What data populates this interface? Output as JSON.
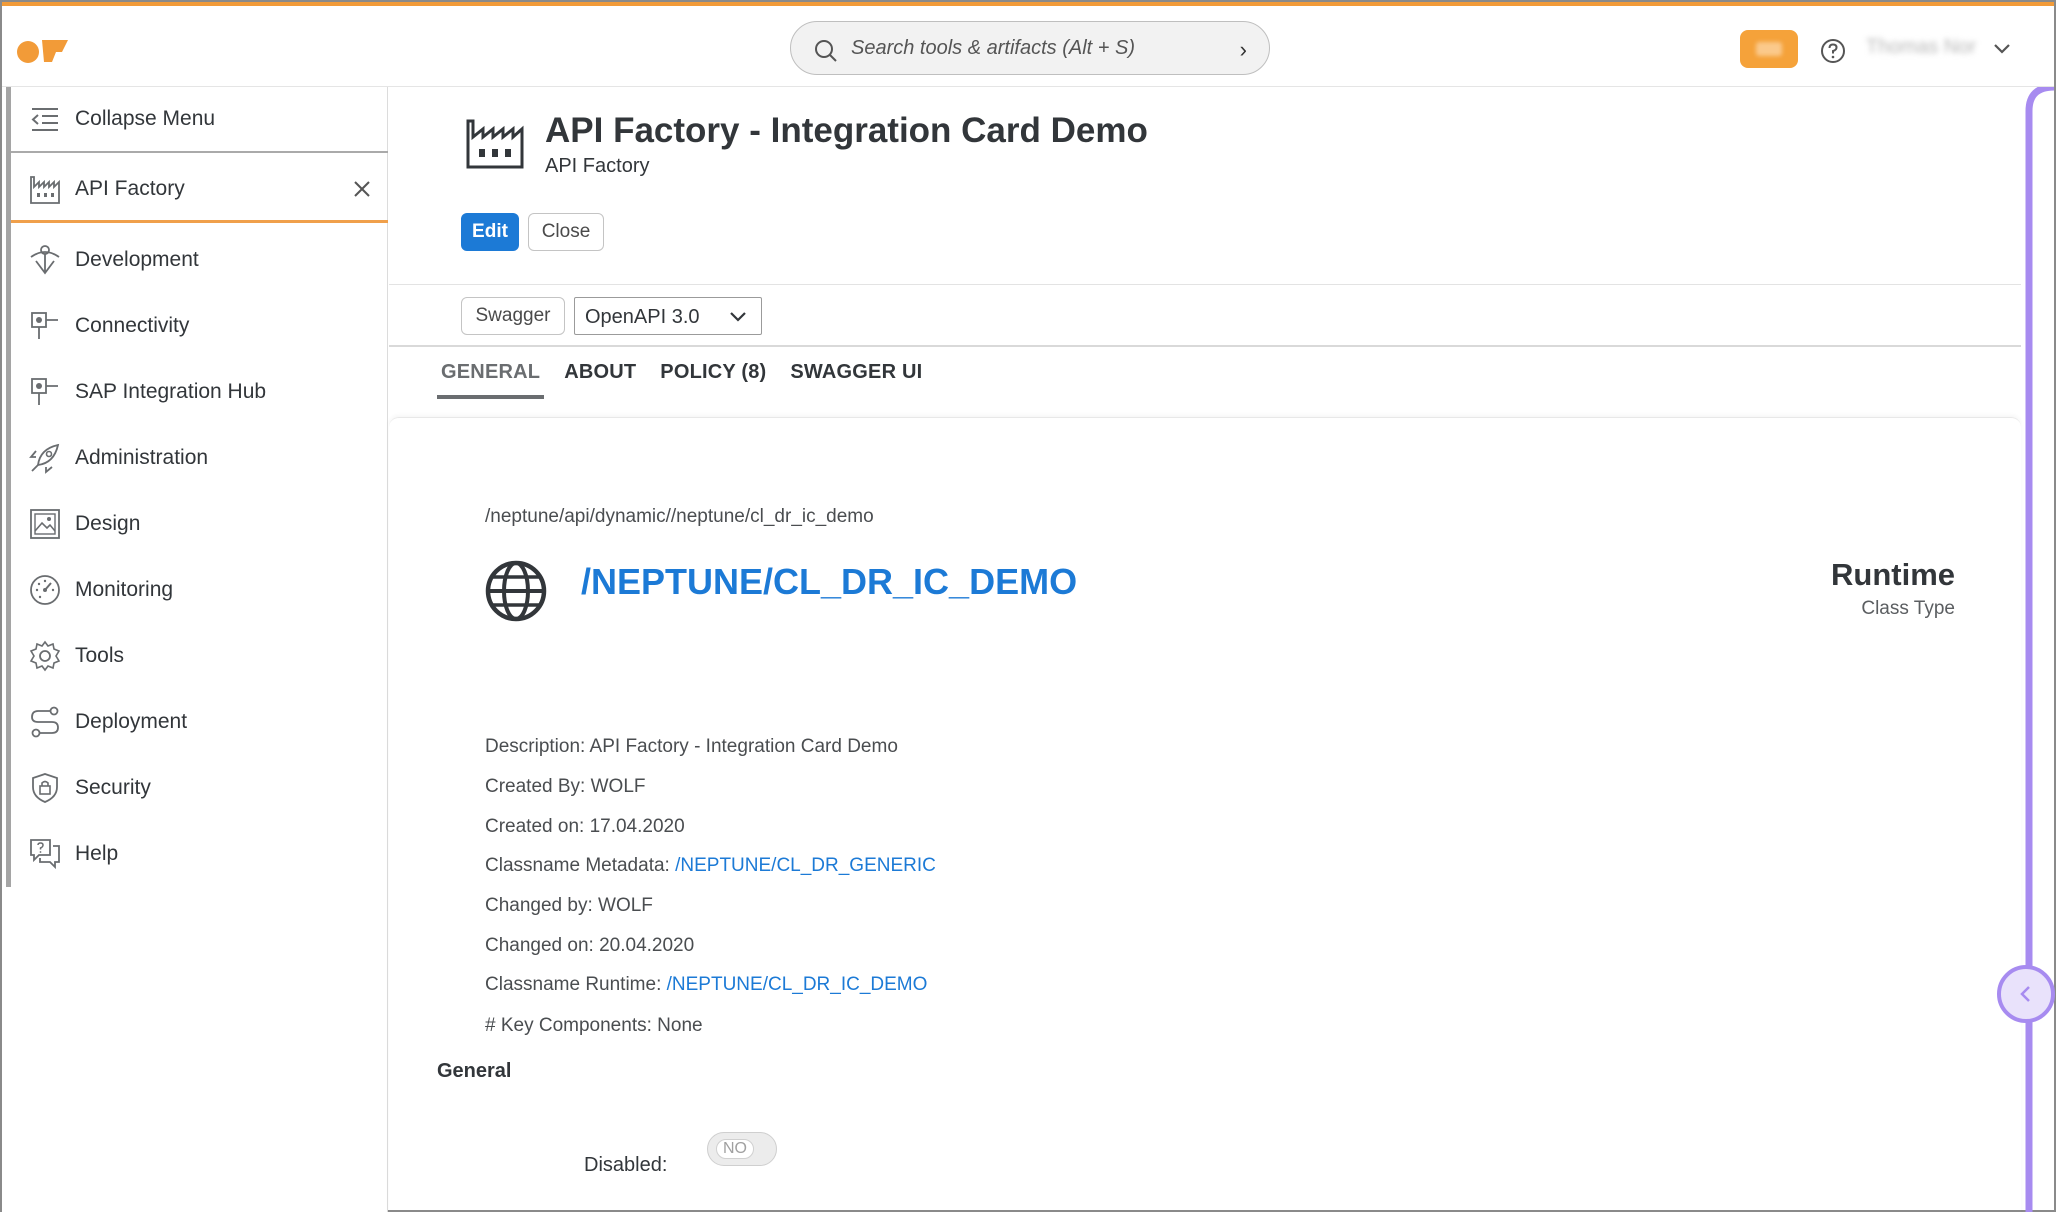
{
  "topbar": {
    "search_placeholder": "Search tools & artifacts (Alt + S)",
    "user_name": "Thomas Nor",
    "accent": "#f29b38"
  },
  "sidebar": {
    "collapse_label": "Collapse Menu",
    "open_app_label": "API Factory",
    "items": [
      {
        "label": "Development",
        "icon": "development-icon"
      },
      {
        "label": "Connectivity",
        "icon": "connectivity-icon"
      },
      {
        "label": "SAP Integration Hub",
        "icon": "integration-hub-icon"
      },
      {
        "label": "Administration",
        "icon": "rocket-icon"
      },
      {
        "label": "Design",
        "icon": "image-icon"
      },
      {
        "label": "Monitoring",
        "icon": "gauge-icon"
      },
      {
        "label": "Tools",
        "icon": "gear-icon"
      },
      {
        "label": "Deployment",
        "icon": "route-icon"
      },
      {
        "label": "Security",
        "icon": "shield-icon"
      },
      {
        "label": "Help",
        "icon": "help-chat-icon"
      }
    ]
  },
  "header": {
    "title": "API Factory - Integration Card Demo",
    "subtitle": "API Factory",
    "edit_label": "Edit",
    "close_label": "Close"
  },
  "toolbar": {
    "swagger_label": "Swagger",
    "spec_version": "OpenAPI 3.0"
  },
  "tabs": [
    {
      "label": "GENERAL",
      "active": true
    },
    {
      "label": "ABOUT",
      "active": false
    },
    {
      "label": "POLICY (8)",
      "active": false
    },
    {
      "label": "SWAGGER UI",
      "active": false
    }
  ],
  "detail": {
    "path": "/neptune/api/dynamic//neptune/cl_dr_ic_demo",
    "class_name": "/NEPTUNE/CL_DR_IC_DEMO",
    "runtime_title": "Runtime",
    "runtime_sub": "Class Type",
    "description": "Description: API Factory - Integration Card Demo",
    "created_by": "Created By: WOLF",
    "created_on": "Created on: 17.04.2020",
    "metadata_label": "Classname Metadata: ",
    "metadata_link": "/NEPTUNE/CL_DR_GENERIC",
    "changed_by": "Changed by: WOLF",
    "changed_on": "Changed on: 20.04.2020",
    "runtime_label": "Classname Runtime: ",
    "runtime_link": "/NEPTUNE/CL_DR_IC_DEMO",
    "key_components": "# Key Components: None"
  },
  "general_section": {
    "title": "General",
    "disabled_label": "Disabled:",
    "disabled_value": "NO"
  },
  "colors": {
    "link": "#1c7ad6",
    "primary_button": "#1c7ad6",
    "rail": "#a78bf0"
  }
}
